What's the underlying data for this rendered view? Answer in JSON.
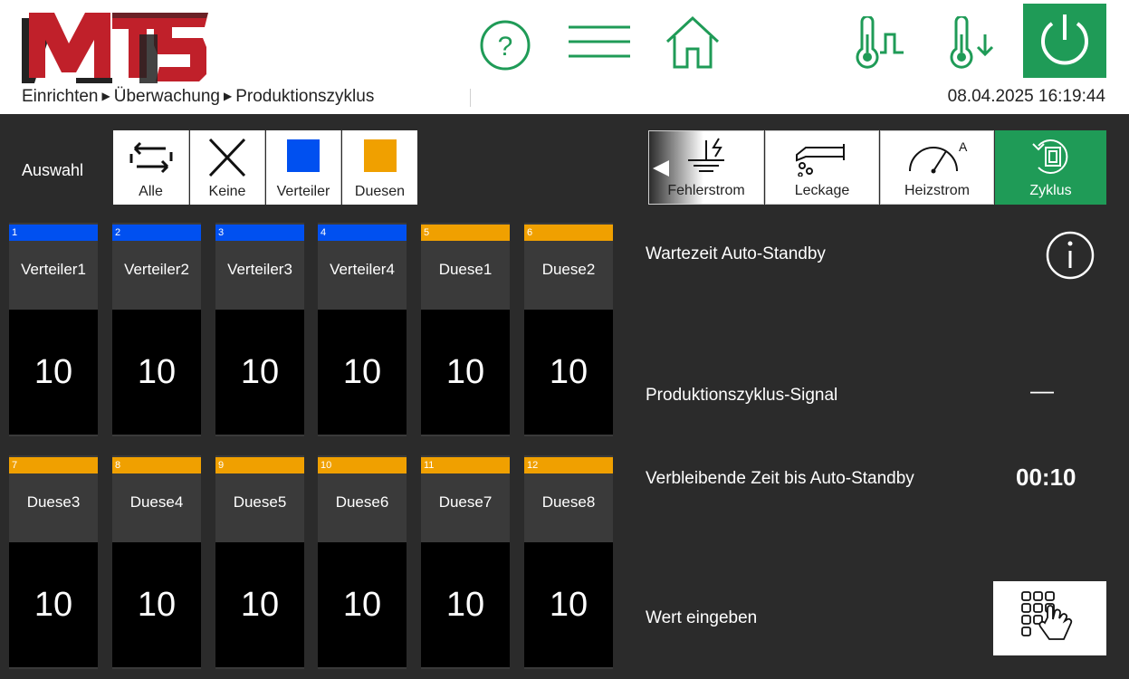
{
  "header": {
    "logo_text": "MTS",
    "breadcrumb": [
      "Einrichten",
      "Überwachung",
      "Produktionszyklus"
    ],
    "datetime": "08.04.2025 16:19:44",
    "icons": [
      "help-icon",
      "menu-icon",
      "home-icon",
      "thermometer-pulse-icon",
      "thermometer-down-icon",
      "power-icon"
    ],
    "accent_color": "#1f9b57"
  },
  "selection": {
    "label": "Auswahl",
    "buttons": [
      {
        "label": "Alle",
        "icon": "select-all-icon"
      },
      {
        "label": "Keine",
        "icon": "close-icon"
      },
      {
        "label": "Verteiler",
        "icon": "blue-square-icon",
        "color": "#0050f0"
      },
      {
        "label": "Duesen",
        "icon": "orange-square-icon",
        "color": "#f0a000"
      }
    ]
  },
  "zones": [
    {
      "num": "1",
      "name": "Verteiler1",
      "value": "10",
      "color": "#0050f0"
    },
    {
      "num": "2",
      "name": "Verteiler2",
      "value": "10",
      "color": "#0050f0"
    },
    {
      "num": "3",
      "name": "Verteiler3",
      "value": "10",
      "color": "#0050f0"
    },
    {
      "num": "4",
      "name": "Verteiler4",
      "value": "10",
      "color": "#0050f0"
    },
    {
      "num": "5",
      "name": "Duese1",
      "value": "10",
      "color": "#f0a000"
    },
    {
      "num": "6",
      "name": "Duese2",
      "value": "10",
      "color": "#f0a000"
    },
    {
      "num": "7",
      "name": "Duese3",
      "value": "10",
      "color": "#f0a000"
    },
    {
      "num": "8",
      "name": "Duese4",
      "value": "10",
      "color": "#f0a000"
    },
    {
      "num": "9",
      "name": "Duese5",
      "value": "10",
      "color": "#f0a000"
    },
    {
      "num": "10",
      "name": "Duese6",
      "value": "10",
      "color": "#f0a000"
    },
    {
      "num": "11",
      "name": "Duese7",
      "value": "10",
      "color": "#f0a000"
    },
    {
      "num": "12",
      "name": "Duese8",
      "value": "10",
      "color": "#f0a000"
    }
  ],
  "tabs": [
    {
      "label": "Fehlerstrom",
      "icon": "ground-fault-icon"
    },
    {
      "label": "Leckage",
      "icon": "leakage-icon"
    },
    {
      "label": "Heizstrom",
      "icon": "ammeter-icon"
    },
    {
      "label": "Zyklus",
      "icon": "cycle-icon",
      "active": true
    }
  ],
  "details": {
    "wait_label": "Wartezeit Auto-Standby",
    "signal_label": "Produktionszyklus-Signal",
    "signal_value": "—",
    "remaining_label": "Verbleibende Zeit bis Auto-Standby",
    "remaining_value": "00:10",
    "enter_label": "Wert eingeben"
  }
}
